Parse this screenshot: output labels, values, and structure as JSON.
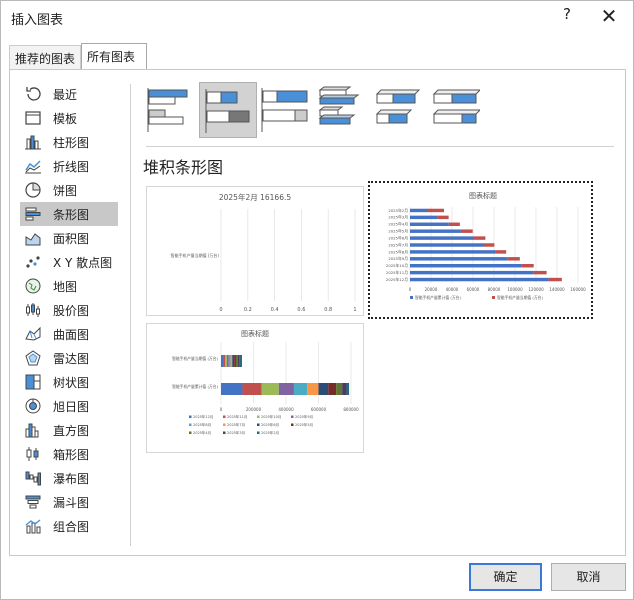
{
  "window": {
    "title": "插入图表",
    "help": "?",
    "close": "✕"
  },
  "tabs": [
    "推荐的图表",
    "所有图表"
  ],
  "sidebar": {
    "items": [
      {
        "label": "最近",
        "icon": "recent-icon"
      },
      {
        "label": "模板",
        "icon": "template-icon"
      },
      {
        "label": "柱形图",
        "icon": "column-chart-icon"
      },
      {
        "label": "折线图",
        "icon": "line-chart-icon"
      },
      {
        "label": "饼图",
        "icon": "pie-chart-icon"
      },
      {
        "label": "条形图",
        "icon": "bar-chart-icon"
      },
      {
        "label": "面积图",
        "icon": "area-chart-icon"
      },
      {
        "label": "X Y 散点图",
        "icon": "scatter-chart-icon"
      },
      {
        "label": "地图",
        "icon": "map-chart-icon"
      },
      {
        "label": "股价图",
        "icon": "stock-chart-icon"
      },
      {
        "label": "曲面图",
        "icon": "surface-chart-icon"
      },
      {
        "label": "雷达图",
        "icon": "radar-chart-icon"
      },
      {
        "label": "树状图",
        "icon": "treemap-chart-icon"
      },
      {
        "label": "旭日图",
        "icon": "sunburst-chart-icon"
      },
      {
        "label": "直方图",
        "icon": "histogram-chart-icon"
      },
      {
        "label": "箱形图",
        "icon": "box-chart-icon"
      },
      {
        "label": "瀑布图",
        "icon": "waterfall-chart-icon"
      },
      {
        "label": "漏斗图",
        "icon": "funnel-chart-icon"
      },
      {
        "label": "组合图",
        "icon": "combo-chart-icon"
      }
    ],
    "selected_index": 5
  },
  "subtypes": {
    "items": [
      "clustered-bar-icon",
      "stacked-bar-icon",
      "100-stacked-bar-icon",
      "3d-clustered-bar-icon",
      "3d-stacked-bar-icon",
      "3d-100-stacked-bar-icon"
    ],
    "selected_index": 1
  },
  "section_title": "堆积条形图",
  "colors": {
    "blue": "#4472c4",
    "orange": "#c0504d",
    "accent": "#3c78d8",
    "selected": "#c8c8c8"
  },
  "chart_data": [
    {
      "type": "bar",
      "title": "2025年2月 16166.5",
      "categories": [
        "智能手机产量当期值 (万台)"
      ],
      "series": [],
      "xlim": [
        0,
        1
      ],
      "xticks": [
        "0",
        "0.2",
        "0.4",
        "0.6",
        "0.8",
        "1"
      ]
    },
    {
      "type": "bar",
      "title": "图表标题",
      "categories": [
        "2025年2月",
        "2025年3月",
        "2025年4月",
        "2025年5月",
        "2025年6月",
        "2025年7月",
        "2025年8月",
        "2025年9月",
        "2025年10月",
        "2025年11月",
        "2025年12月"
      ],
      "series": [
        {
          "name": "智能手机产量累计值 (万台)",
          "values": [
            16166,
            26500,
            37000,
            48500,
            60000,
            70000,
            81000,
            93000,
            106000,
            118000,
            132000
          ]
        },
        {
          "name": "智能手机产量当期值 (万台)",
          "values": [
            16166,
            10300,
            10500,
            11200,
            11800,
            10400,
            10600,
            11600,
            11800,
            12100,
            12600
          ]
        }
      ],
      "xlim": [
        0,
        160000
      ],
      "xticks": [
        "0",
        "20000",
        "40000",
        "60000",
        "80000",
        "100000",
        "120000",
        "140000",
        "160000"
      ],
      "legend": "bottom"
    },
    {
      "type": "bar",
      "title": "图表标题",
      "categories": [
        "智能手机产量当期值 (万台)",
        "智能手机产量累计值 (万台)"
      ],
      "series": [
        {
          "name": "2025年12月",
          "values": [
            12600,
            132000
          ]
        },
        {
          "name": "2025年11月",
          "values": [
            12100,
            118000
          ]
        },
        {
          "name": "2025年10月",
          "values": [
            11800,
            106000
          ]
        },
        {
          "name": "2025年9月",
          "values": [
            11600,
            93000
          ]
        },
        {
          "name": "2025年8月",
          "values": [
            10600,
            81000
          ]
        },
        {
          "name": "2025年7月",
          "values": [
            10400,
            70000
          ]
        },
        {
          "name": "2025年6月",
          "values": [
            11800,
            60000
          ]
        },
        {
          "name": "2025年5月",
          "values": [
            11200,
            48500
          ]
        },
        {
          "name": "2025年4月",
          "values": [
            10500,
            37000
          ]
        },
        {
          "name": "2025年3月",
          "values": [
            10300,
            26500
          ]
        },
        {
          "name": "2025年2月",
          "values": [
            16166,
            16166
          ]
        }
      ],
      "series_colors": [
        "#4472c4",
        "#c0504d",
        "#9bbb59",
        "#8064a2",
        "#4bacc6",
        "#f79646",
        "#2c4d75",
        "#772c2a",
        "#5f7530",
        "#4d3b62",
        "#276a7c"
      ],
      "xlim": [
        0,
        800000
      ],
      "xticks": [
        "0",
        "200000",
        "400000",
        "600000",
        "800000"
      ],
      "legend": "bottom"
    }
  ],
  "buttons": {
    "ok": "确定",
    "cancel": "取消"
  }
}
